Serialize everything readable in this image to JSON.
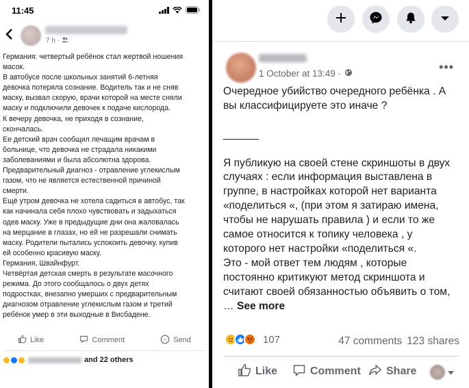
{
  "left": {
    "status": {
      "time": "11:45"
    },
    "header": {
      "time_ago": "7 h ·"
    },
    "post_text": "Германия: четвертый ребёнок стал жертвой ношения\nмасок.\nВ автобусе после школьных занятий 6-летняя\nдевочка потеряла сознание. Водитель так и не сняв\nмаску, вызвал скорую, врачи которой на месте сняли\nмаску и подключили девочек к подаче кислорода.\nК вечеру девочка, не приходя в сознание,\nскончалась.\nЕе детский врач сообщил лечащим врачам в\nбольнице, что девочка не страдала никакими\nзаболеваниями и была абсолютна здорова.\nПредварительный диагноз - отравление углекислым\nгазом, что не является естественной причиной\nсмерти.\nЕщё утром девочка не хотела садиться в автобус, так\nкак начинала себя плохо чувствовать и задыхаться\nодев маску. Уже в предыдущие дни она жаловалась\nна мерцание в глазах, но ей не разрешали снимать\nмаску. Родители пытались успокоить девочку, купив\nей особенно красивую маску.\nГермания, Швайнфурт.\nЧетвёртая детская смерть в результате масочного\nрежима. До этого сообщалось о двух детях\nподростках, внезапно умерших с предварительным\nдиагнозом отравление углекислым газом и третий\nребёнок умер в эти выходные в Висбадене.",
    "actions": {
      "like": "Like",
      "comment": "Comment",
      "send": "Send"
    },
    "reactions_text": "and 22 others"
  },
  "right": {
    "meta_time": "1 October at 13:49 ·",
    "post_text": "Очередное убийство очередного ребёнка . А\nвы классифицируете это иначе ?\n\n______\n\nЯ публикую на своей стене скриншоты в двух\nслучаях : если информация выставлена в\nгруппе, в настройках которой нет варианта\n«поделиться «, (при этом я затираю имена,\nчтобы не нарушать правила ) и если то же\nсамое относится к топику человека , у\nкоторого нет настройки «поделиться «.\nЭто - мой ответ тем людям , которые\nпостоянно критикуют метод скриншота и\nсчитают своей обязанностью объявить о том,\n… ",
    "see_more": "See more",
    "reaction_count": "107",
    "comments": "47 comments",
    "shares": "123 shares",
    "actions": {
      "like": "Like",
      "comment": "Comment",
      "share": "Share"
    }
  },
  "colors": {
    "brand_blue": "#1877f2",
    "text_grey": "#65676b",
    "icon_bg": "#e4e6eb"
  },
  "icons": [
    "back-arrow",
    "plus",
    "messenger",
    "bell",
    "caret-down",
    "globe",
    "like-thumb",
    "comment-bubble",
    "share-arrow",
    "send-arrow"
  ]
}
